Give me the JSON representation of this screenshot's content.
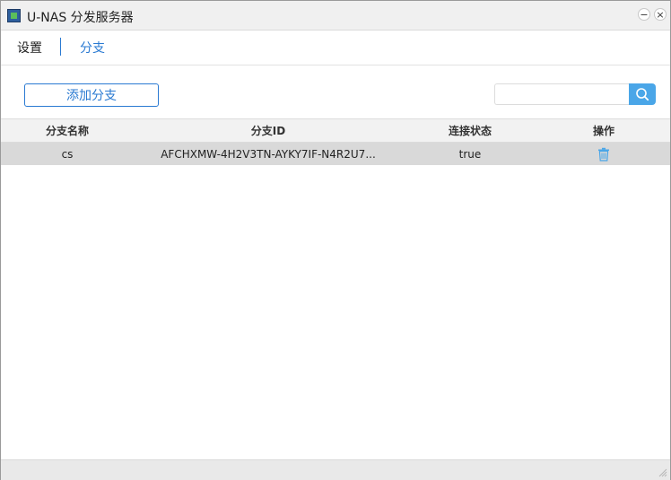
{
  "window": {
    "title": "U-NAS 分发服务器",
    "app_icon": "app-logo-icon",
    "minimize_symbol": "−",
    "close_symbol": "×"
  },
  "nav": {
    "tabs": [
      {
        "label": "设置",
        "active": false
      },
      {
        "label": "分支",
        "active": true
      }
    ]
  },
  "toolbar": {
    "add_button_label": "添加分支",
    "search_placeholder": "",
    "search_value": "",
    "search_icon": "search-icon"
  },
  "table": {
    "columns": [
      "分支名称",
      "分支ID",
      "连接状态",
      "操作"
    ],
    "rows": [
      {
        "name": "cs",
        "id": "AFCHXMW-4H2V3TN-AYKY7IF-N4R2U7...",
        "status": "true",
        "action_icon": "trash-icon"
      }
    ]
  },
  "colors": {
    "accent": "#2a7ad2",
    "search_button": "#4aa6e8",
    "row_selected": "#d9d9d9",
    "header_bg": "#f2f2f2"
  }
}
